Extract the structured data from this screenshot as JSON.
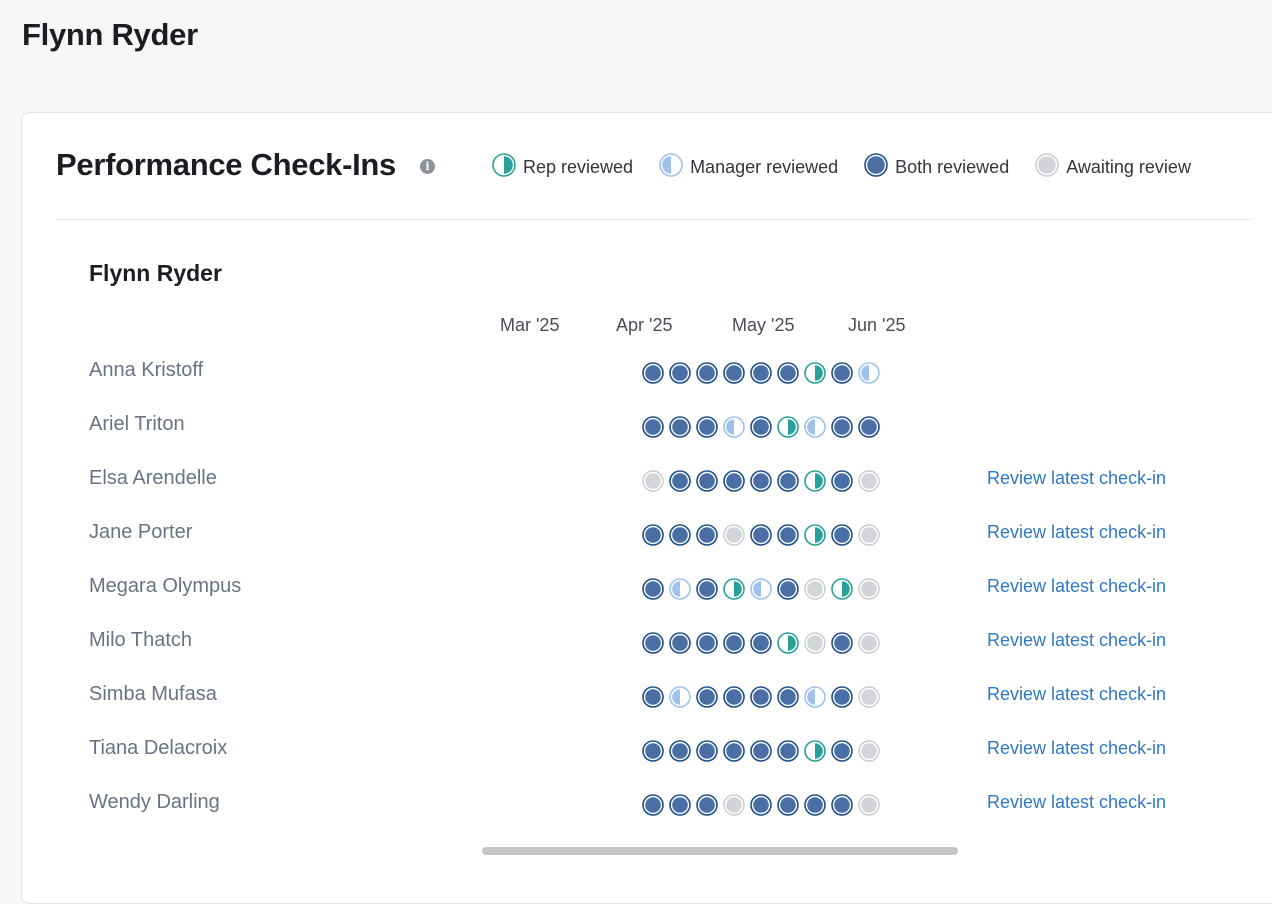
{
  "page": {
    "title": "Flynn Ryder"
  },
  "card": {
    "title": "Performance Check-Ins",
    "info_icon": "info-icon",
    "legend": [
      {
        "key": "rep",
        "label": "Rep reviewed"
      },
      {
        "key": "manager",
        "label": "Manager reviewed"
      },
      {
        "key": "both",
        "label": "Both reviewed"
      },
      {
        "key": "awaiting",
        "label": "Awaiting review"
      }
    ],
    "colors": {
      "both_fill": "#4a6fa5",
      "both_ring": "#1f4e8c",
      "rep_accent": "#2aa198",
      "manager_accent": "#9ec2ec",
      "awaiting_fill": "#d3d4d8",
      "link": "#2f78c8"
    }
  },
  "section": {
    "manager_name": "Flynn Ryder",
    "months": [
      "Mar '25",
      "Apr '25",
      "May '25",
      "Jun '25"
    ],
    "review_link_label": "Review latest check-in",
    "rows": [
      {
        "name": "Anna Kristoff",
        "dots": [
          "both",
          "both",
          "both",
          "both",
          "both",
          "both",
          "rep",
          "both",
          "manager"
        ],
        "has_link": false
      },
      {
        "name": "Ariel Triton",
        "dots": [
          "both",
          "both",
          "both",
          "manager",
          "both",
          "rep",
          "manager",
          "both",
          "both"
        ],
        "has_link": false
      },
      {
        "name": "Elsa Arendelle",
        "dots": [
          "awaiting",
          "both",
          "both",
          "both",
          "both",
          "both",
          "rep",
          "both",
          "awaiting"
        ],
        "has_link": true
      },
      {
        "name": "Jane Porter",
        "dots": [
          "both",
          "both",
          "both",
          "awaiting",
          "both",
          "both",
          "rep",
          "both",
          "awaiting"
        ],
        "has_link": true
      },
      {
        "name": "Megara Olympus",
        "dots": [
          "both",
          "manager",
          "both",
          "rep",
          "manager",
          "both",
          "awaiting",
          "rep",
          "awaiting"
        ],
        "has_link": true
      },
      {
        "name": "Milo Thatch",
        "dots": [
          "both",
          "both",
          "both",
          "both",
          "both",
          "rep",
          "awaiting",
          "both",
          "awaiting"
        ],
        "has_link": true
      },
      {
        "name": "Simba Mufasa",
        "dots": [
          "both",
          "manager",
          "both",
          "both",
          "both",
          "both",
          "manager",
          "both",
          "awaiting"
        ],
        "has_link": true
      },
      {
        "name": "Tiana Delacroix",
        "dots": [
          "both",
          "both",
          "both",
          "both",
          "both",
          "both",
          "rep",
          "both",
          "awaiting"
        ],
        "has_link": true
      },
      {
        "name": "Wendy Darling",
        "dots": [
          "both",
          "both",
          "both",
          "awaiting",
          "both",
          "both",
          "both",
          "both",
          "awaiting"
        ],
        "has_link": true
      }
    ]
  }
}
